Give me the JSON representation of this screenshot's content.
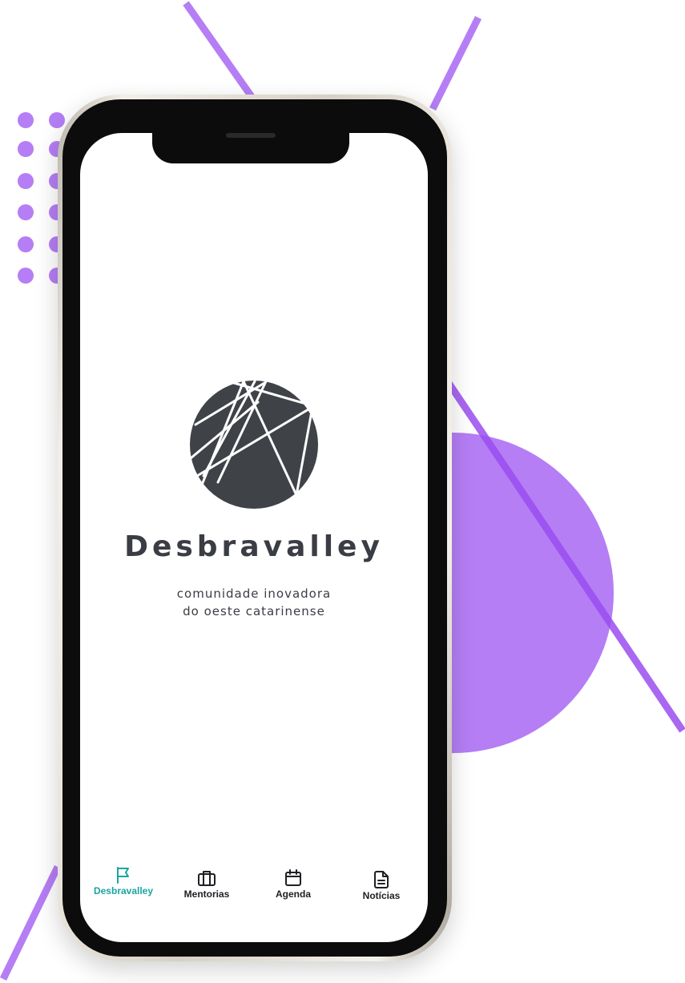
{
  "colors": {
    "accent_purple": "#b57ef5",
    "active_tab": "#1aa5a0",
    "text_dark": "#3a3d44",
    "logo_fill": "#3f4247"
  },
  "app": {
    "brand_name": "Desbravalley",
    "tagline_line1": "comunidade inovadora",
    "tagline_line2": "do oeste catarinense"
  },
  "navbar": {
    "tabs": [
      {
        "label": "Desbravalley",
        "icon": "flag-icon",
        "active": true
      },
      {
        "label": "Mentorias",
        "icon": "briefcase-icon",
        "active": false
      },
      {
        "label": "Agenda",
        "icon": "calendar-icon",
        "active": false
      },
      {
        "label": "Notícias",
        "icon": "document-icon",
        "active": false
      }
    ]
  }
}
